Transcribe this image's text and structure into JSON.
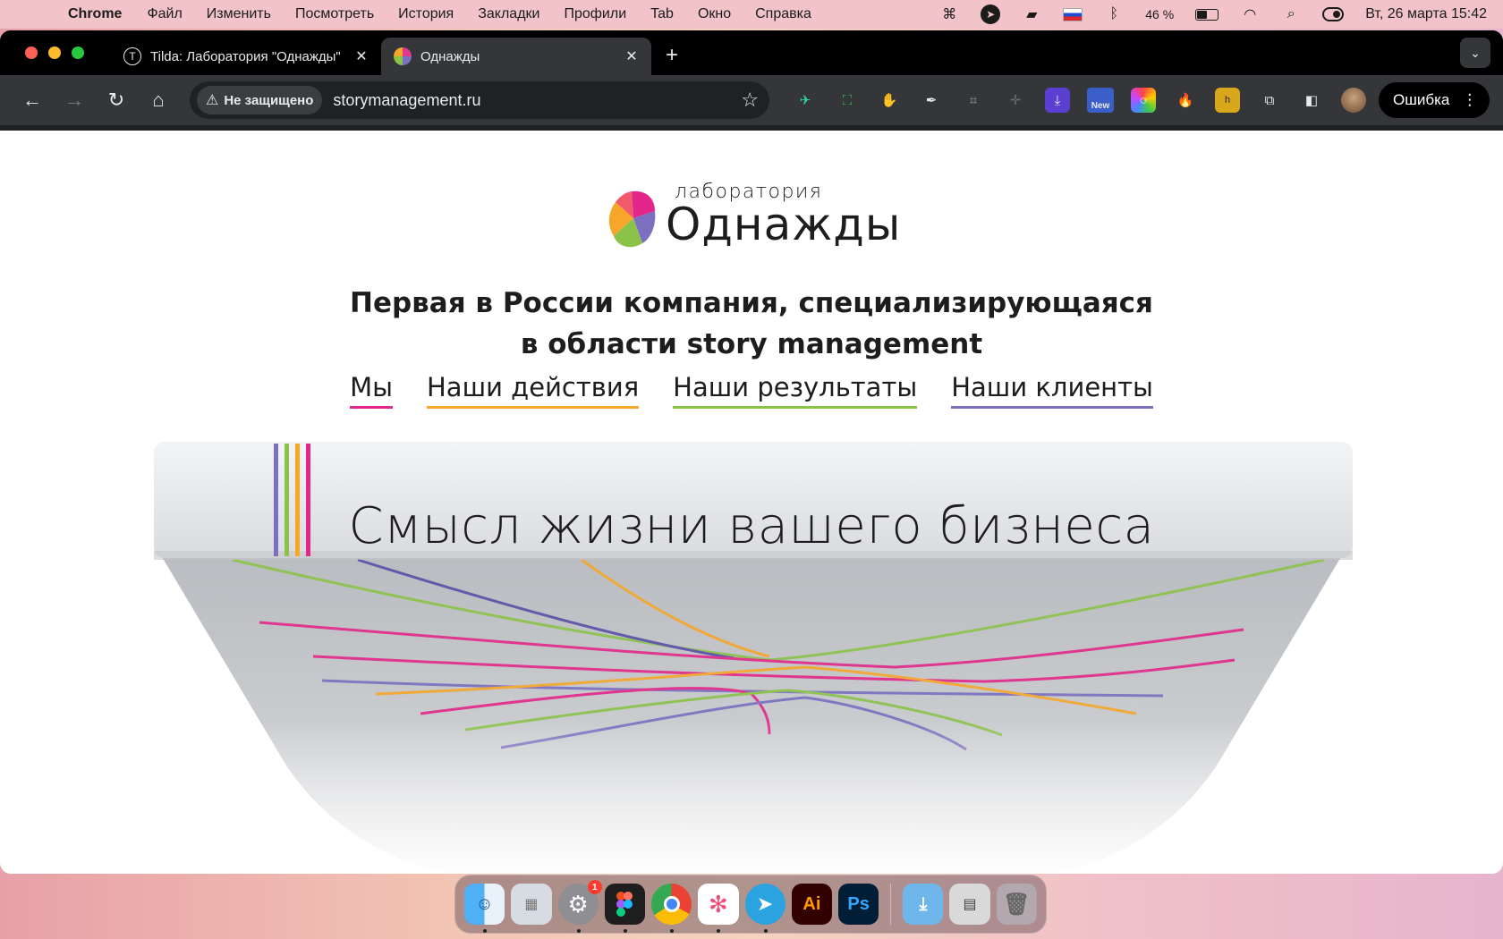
{
  "menubar": {
    "app_name": "Chrome",
    "menus": [
      "Файл",
      "Изменить",
      "Посмотреть",
      "История",
      "Закладки",
      "Профили",
      "Tab",
      "Окно",
      "Справка"
    ],
    "battery": "46 %",
    "datetime": "Вт, 26 марта  15:42"
  },
  "tabs": [
    {
      "title": "Tilda: Лаборатория \"Однажды\"",
      "favicon": "tilda-icon",
      "active": false
    },
    {
      "title": "Однажды",
      "favicon": "once-logo-icon",
      "active": true
    }
  ],
  "toolbar": {
    "security_label": "Не защищено",
    "url": "storymanagement.ru",
    "new_badge": "New",
    "profile_button": "Ошибка"
  },
  "page": {
    "logo_small": "лаборатория",
    "logo_big": "Однажды",
    "headline_line1": "Первая в России компания, специализирующаяся",
    "headline_line2": "в области story management",
    "nav": [
      {
        "label": "Мы",
        "color": "#e3278a"
      },
      {
        "label": "Наши действия",
        "color": "#f6a72a"
      },
      {
        "label": "Наши результаты",
        "color": "#8bc34a"
      },
      {
        "label": "Наши клиенты",
        "color": "#7b6fc0"
      }
    ],
    "hero_text": "Смысл жизни вашего бизнеса"
  },
  "dock": {
    "apps": [
      "Finder",
      "Launchpad",
      "System Settings",
      "Figma",
      "Chrome",
      "Pinwheel",
      "Telegram",
      "Illustrator",
      "Photoshop",
      "Downloads",
      "Files",
      "Trash"
    ],
    "settings_badge": "1",
    "ai_label": "Ai",
    "ps_label": "Ps"
  }
}
